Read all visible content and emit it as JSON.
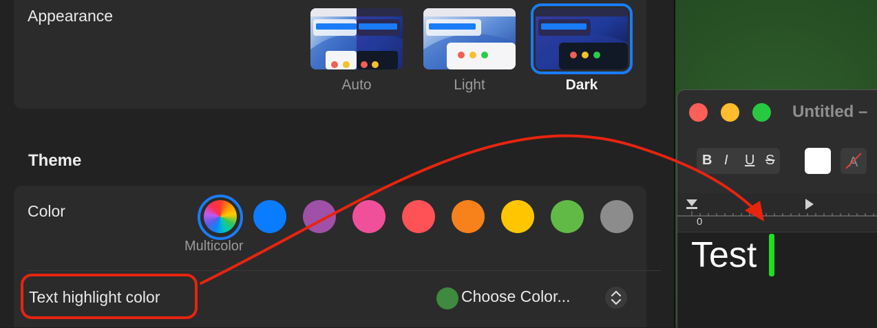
{
  "appearance": {
    "label": "Appearance",
    "options": [
      {
        "label": "Auto",
        "selected": false
      },
      {
        "label": "Light",
        "selected": false
      },
      {
        "label": "Dark",
        "selected": true
      }
    ]
  },
  "theme": {
    "title": "Theme",
    "color_label": "Color",
    "swatches": [
      {
        "name": "Multicolor",
        "color": "multicolor",
        "selected": true
      },
      {
        "name": "blue",
        "color": "#0a7cff"
      },
      {
        "name": "purple",
        "color": "#a050a8"
      },
      {
        "name": "pink",
        "color": "#f0509a"
      },
      {
        "name": "red",
        "color": "#ff5257"
      },
      {
        "name": "orange",
        "color": "#f7821b"
      },
      {
        "name": "yellow",
        "color": "#ffc600"
      },
      {
        "name": "green",
        "color": "#62ba46"
      },
      {
        "name": "graphite",
        "color": "#8c8c8c"
      }
    ],
    "multicolor_label": "Multicolor",
    "highlight_label": "Text highlight color",
    "highlight_value": "Choose Color...",
    "highlight_swatch": "#3f8a3e"
  },
  "textedit": {
    "title": "Untitled –",
    "format_buttons": [
      "B",
      "I",
      "U",
      "S"
    ],
    "ruler_zero": "0",
    "document_text": "Test",
    "cursor_color": "#22dd22"
  },
  "annotation": {
    "color": "#e8240f"
  }
}
